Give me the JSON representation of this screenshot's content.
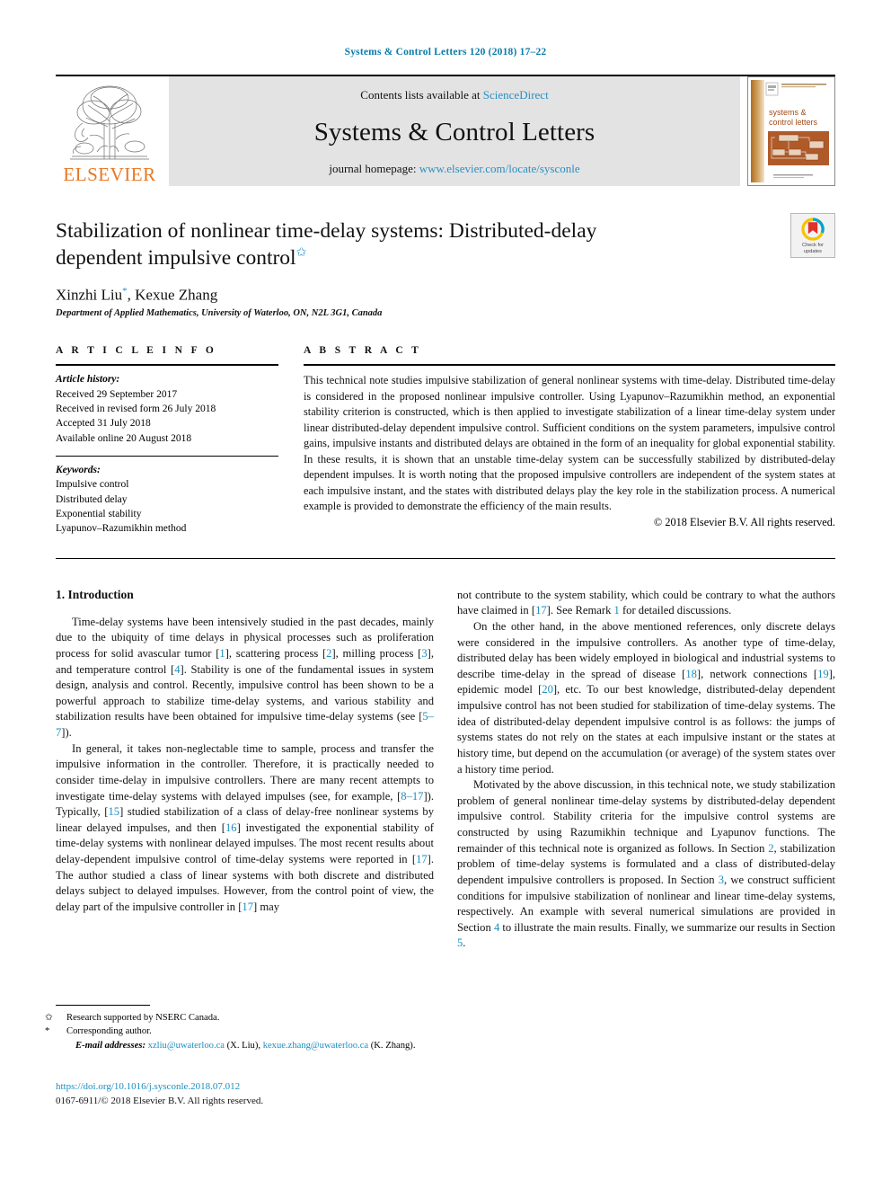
{
  "running_head": "Systems & Control Letters 120 (2018) 17–22",
  "masthead": {
    "publisher_name": "ELSEVIER",
    "contents_prefix": "Contents lists available at ",
    "contents_link": "ScienceDirect",
    "journal_name": "Systems & Control Letters",
    "homepage_prefix": "journal homepage: ",
    "homepage_url": "www.elsevier.com/locate/sysconle",
    "cover": {
      "line1": "systems &",
      "line2": "control letters"
    }
  },
  "article": {
    "title": "Stabilization of nonlinear time-delay systems: Distributed-delay dependent impulsive control",
    "title_footnote_mark": "✩",
    "authors": "Xinzhi Liu",
    "authors_corr_mark": "*",
    "authors_rest": ", Kexue Zhang",
    "affiliation": "Department of Applied Mathematics, University of Waterloo, ON, N2L 3G1, Canada",
    "crossmark": {
      "line1": "Check for",
      "line2": "updates"
    }
  },
  "article_info": {
    "label": "A R T I C L E   I N F O",
    "history_title": "Article history:",
    "history": [
      "Received 29 September 2017",
      "Received in revised form 26 July 2018",
      "Accepted 31 July 2018",
      "Available online 20 August 2018"
    ],
    "keywords_title": "Keywords:",
    "keywords": [
      "Impulsive control",
      "Distributed delay",
      "Exponential stability",
      "Lyapunov–Razumikhin method"
    ]
  },
  "abstract": {
    "label": "A B S T R A C T",
    "text": "This technical note studies impulsive stabilization of general nonlinear systems with time-delay. Distributed time-delay is considered in the proposed nonlinear impulsive controller. Using Lyapunov–Razumikhin method, an exponential stability criterion is constructed, which is then applied to investigate stabilization of a linear time-delay system under linear distributed-delay dependent impulsive control. Sufficient conditions on the system parameters, impulsive control gains, impulsive instants and distributed delays are obtained in the form of an inequality for global exponential stability. In these results, it is shown that an unstable time-delay system can be successfully stabilized by distributed-delay dependent impulses. It is worth noting that the proposed impulsive controllers are independent of the system states at each impulsive instant, and the states with distributed delays play the key role in the stabilization process. A numerical example is provided to demonstrate the efficiency of the main results.",
    "copyright": "© 2018 Elsevier B.V. All rights reserved."
  },
  "body": {
    "section_heading": "1. Introduction",
    "left_paragraphs": [
      "Time-delay systems have been intensively studied in the past decades, mainly due to the ubiquity of time delays in physical processes such as proliferation process for solid avascular tumor [1], scattering process [2], milling process [3], and temperature control [4]. Stability is one of the fundamental issues in system design, analysis and control. Recently, impulsive control has been shown to be a powerful approach to stabilize time-delay systems, and various stability and stabilization results have been obtained for impulsive time-delay systems (see [5–7]).",
      "In general, it takes non-neglectable time to sample, process and transfer the impulsive information in the controller. Therefore, it is practically needed to consider time-delay in impulsive controllers. There are many recent attempts to investigate time-delay systems with delayed impulses (see, for example, [8–17]). Typically, [15] studied stabilization of a class of delay-free nonlinear systems by linear delayed impulses, and then [16] investigated the exponential stability of time-delay systems with nonlinear delayed impulses. The most recent results about delay-dependent impulsive control of time-delay systems were reported in [17]. The author studied a class of linear systems with both discrete and distributed delays subject to delayed impulses. However, from the control point of view, the delay part of the impulsive controller in [17] may"
    ],
    "right_paragraphs": [
      "not contribute to the system stability, which could be contrary to what the authors have claimed in [17]. See Remark 1 for detailed discussions.",
      "On the other hand, in the above mentioned references, only discrete delays were considered in the impulsive controllers. As another type of time-delay, distributed delay has been widely employed in biological and industrial systems to describe time-delay in the spread of disease [18], network connections [19], epidemic model [20], etc. To our best knowledge, distributed-delay dependent impulsive control has not been studied for stabilization of time-delay systems. The idea of distributed-delay dependent impulsive control is as follows: the jumps of systems states do not rely on the states at each impulsive instant or the states at history time, but depend on the accumulation (or average) of the system states over a history time period.",
      "Motivated by the above discussion, in this technical note, we study stabilization problem of general nonlinear time-delay systems by distributed-delay dependent impulsive control. Stability criteria for the impulsive control systems are constructed by using Razumikhin technique and Lyapunov functions. The remainder of this technical note is organized as follows. In Section 2, stabilization problem of time-delay systems is formulated and a class of distributed-delay dependent impulsive controllers is proposed. In Section 3, we construct sufficient conditions for impulsive stabilization of nonlinear and linear time-delay systems, respectively. An example with several numerical simulations are provided in Section 4 to illustrate the main results. Finally, we summarize our results in Section 5."
    ]
  },
  "footnotes": {
    "funding_mark": "✩",
    "funding": "Research supported by NSERC Canada.",
    "corresponding_mark": "*",
    "corresponding": "Corresponding author.",
    "email_label": "E-mail addresses:",
    "email1": "xzliu@uwaterloo.ca",
    "email1_who": "(X. Liu),",
    "email2": "kexue.zhang@uwaterloo.ca",
    "email2_who": "(K. Zhang)."
  },
  "publication_footer": {
    "doi": "https://doi.org/10.1016/j.sysconle.2018.07.012",
    "issn": "0167-6911/© 2018 Elsevier B.V. All rights reserved."
  },
  "colors": {
    "link_blue": "#1a8fc1",
    "header_blue": "#0b7bab",
    "elsevier_orange": "#e87722",
    "band_gray": "#e3e3e3"
  }
}
